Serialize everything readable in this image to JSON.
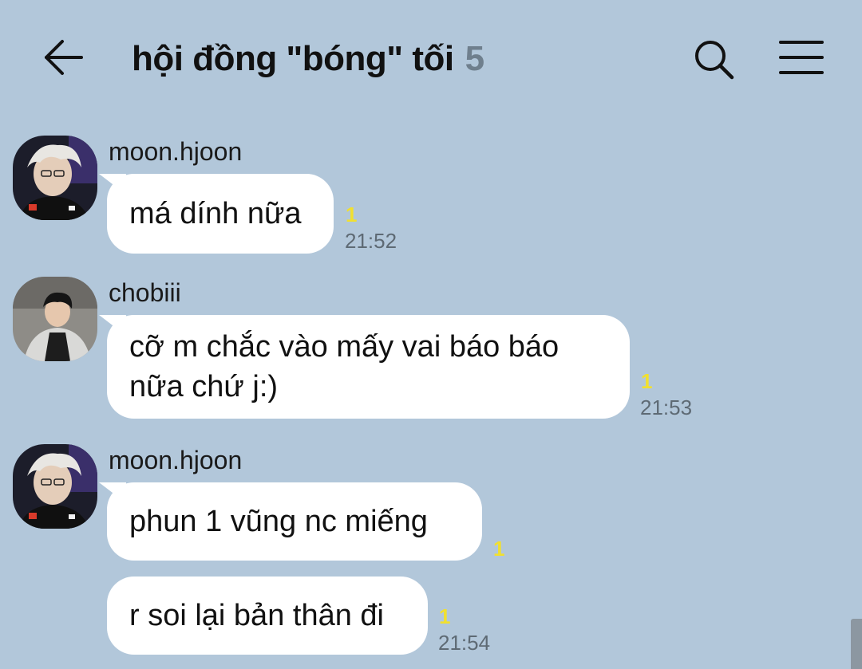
{
  "header": {
    "title": "hội đồng \"bóng\" tối",
    "member_count": "5",
    "back_icon": "arrow-left-icon",
    "search_icon": "search-icon",
    "menu_icon": "hamburger-menu-icon"
  },
  "colors": {
    "background": "#b2c7da",
    "bubble": "#ffffff",
    "unread": "#f1e02f",
    "time": "#5e6a74",
    "member_count": "#6f7f8d"
  },
  "messages": [
    {
      "sender": "moon.hjoon",
      "text": "má dính nữa",
      "unread": "1",
      "time": "21:52"
    },
    {
      "sender": "chobiii",
      "text": "cỡ m chắc vào mấy vai báo báo\nnữa chứ j:)",
      "unread": "1",
      "time": "21:53"
    },
    {
      "sender": "moon.hjoon",
      "text": "phun 1 vũng nc miếng",
      "unread": "1",
      "time": ""
    },
    {
      "sender": "",
      "text": "r soi lại bản thân đi",
      "unread": "1",
      "time": "21:54"
    }
  ]
}
